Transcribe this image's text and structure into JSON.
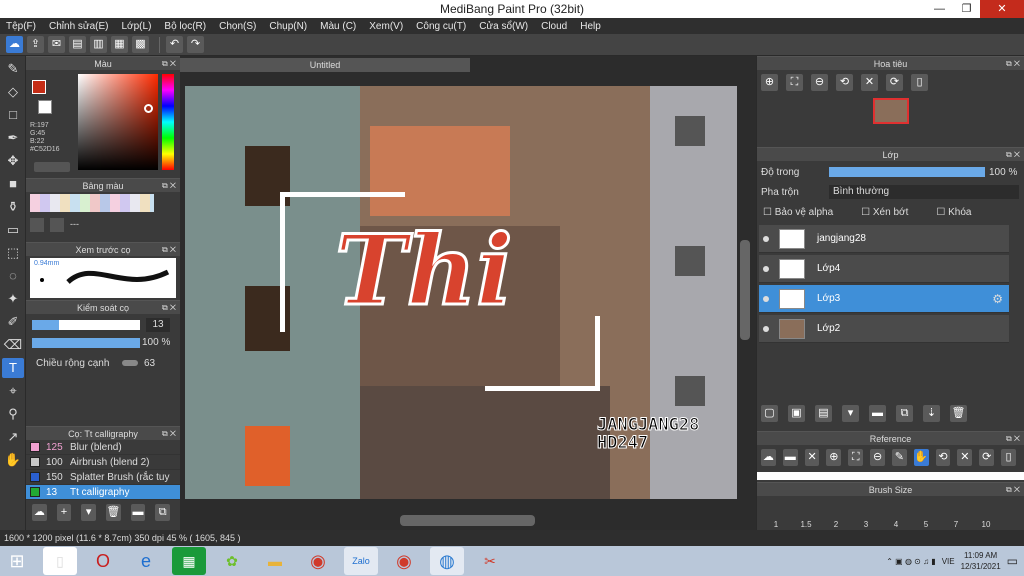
{
  "window": {
    "title": "MediBang Paint Pro (32bit)",
    "min": "—",
    "max": "❐",
    "close": "✕"
  },
  "menu": [
    "Tệp(F)",
    "Chỉnh sửa(E)",
    "Lớp(L)",
    "Bộ lọc(R)",
    "Chọn(S)",
    "Chụp(N)",
    "Màu (C)",
    "Xem(V)",
    "Công cụ(T)",
    "Cửa sổ(W)",
    "Cloud",
    "Help"
  ],
  "document": {
    "tab": "Untitled"
  },
  "color_panel": {
    "title": "Màu",
    "r": "R:197",
    "g": "G:45",
    "b": "B:22",
    "hex": "#C52D16",
    "accent": "#C52D16"
  },
  "palette_panel": {
    "title": "Bảng màu",
    "extra": "---"
  },
  "brush_preview": {
    "title": "Xem trước cọ",
    "size": "0.94mm"
  },
  "brush_control": {
    "title": "Kiểm soát cọ",
    "size_value": "13",
    "opacity_value": "100 %",
    "edge_label": "Chiều rộng cạnh",
    "edge_value": "63"
  },
  "brush_list": {
    "title": "Cọ: Tt calligraphy",
    "items": [
      {
        "size": "125",
        "name": "Blur (blend)",
        "color": "#f0a0d0"
      },
      {
        "size": "100",
        "name": "Airbrush (blend 2)",
        "color": "#c8c8c8"
      },
      {
        "size": "150",
        "name": "Splatter Brush (rắc tuy",
        "color": "#2a5fd0"
      },
      {
        "size": "13",
        "name": "Tt calligraphy",
        "color": "#22aa33"
      }
    ]
  },
  "artwork": {
    "main_text": "Thi",
    "credit_line1": "JANGJANG28",
    "credit_line2": "HD247"
  },
  "navigator": {
    "title": "Hoa tiêu"
  },
  "layers": {
    "title": "Lớp",
    "opacity_label": "Độ trong",
    "opacity_value": "100 %",
    "opacity": 1.0,
    "blend_label": "Pha trộn",
    "blend_value": "Bình thường",
    "protect_alpha": "Bảo vệ alpha",
    "clipping": "Xén bớt",
    "lock": "Khóa",
    "items": [
      {
        "name": "jangjang28",
        "selected": false
      },
      {
        "name": "Lớp4",
        "selected": false
      },
      {
        "name": "Lớp3",
        "selected": true
      },
      {
        "name": "Lớp2",
        "selected": false
      }
    ]
  },
  "reference": {
    "title": "Reference"
  },
  "brush_size": {
    "title": "Brush Size",
    "sizes": [
      "1",
      "1.5",
      "2",
      "3",
      "4",
      "5",
      "7",
      "10"
    ]
  },
  "status": {
    "text": "1600 * 1200 pixel   (11.6 * 8.7cm)   350 dpi   45 %   ( 1605, 845 )"
  },
  "taskbar": {
    "lang": "VIE",
    "time": "11:09 AM",
    "date": "12/31/2021"
  }
}
